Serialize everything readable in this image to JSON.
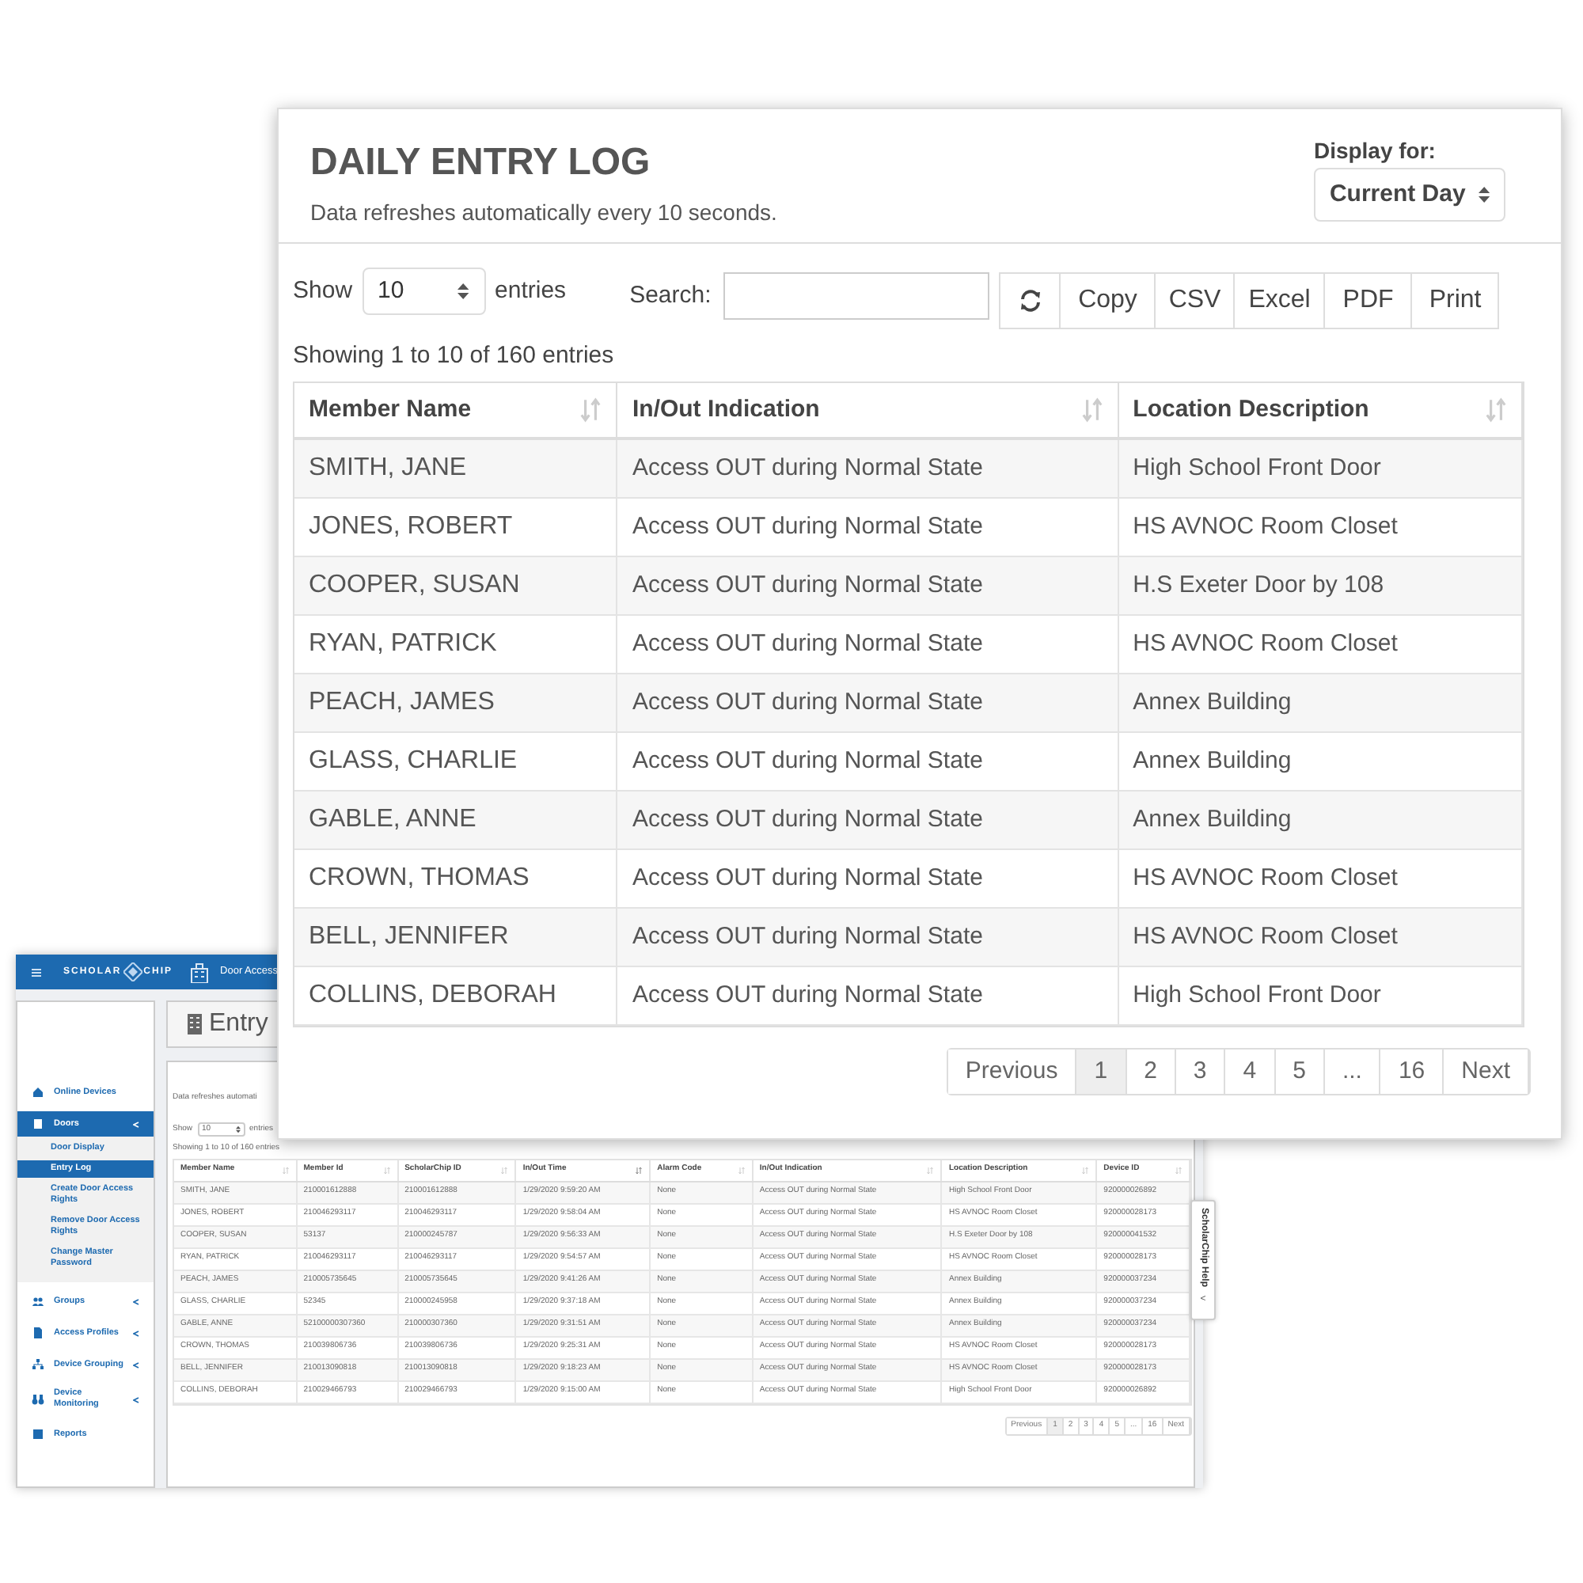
{
  "back_window": {
    "header": {
      "logo_left": "SCHOLAR",
      "logo_right": "CHIP",
      "app_title": "Door Access"
    },
    "sidebar": {
      "items": [
        {
          "label": "Online Devices",
          "selected": false,
          "expandable": false
        },
        {
          "label": "Doors",
          "selected": true,
          "expandable": true,
          "children": [
            {
              "label": "Door Display",
              "selected": false
            },
            {
              "label": "Entry Log",
              "selected": true
            },
            {
              "label": "Create Door Access Rights",
              "selected": false
            },
            {
              "label": "Remove Door Access Rights",
              "selected": false
            },
            {
              "label": "Change Master Password",
              "selected": false
            }
          ]
        },
        {
          "label": "Groups",
          "selected": false,
          "expandable": true
        },
        {
          "label": "Access Profiles",
          "selected": false,
          "expandable": true
        },
        {
          "label": "Device Grouping",
          "selected": false,
          "expandable": true
        },
        {
          "label": "Device Monitoring",
          "selected": false,
          "expandable": true
        },
        {
          "label": "Reports",
          "selected": false,
          "expandable": false
        }
      ]
    },
    "page_title": "Entry",
    "subtitle": "Data refreshes automati",
    "show_label": "Show",
    "page_size": "10",
    "entries_label": "entries",
    "info": "Showing 1 to 10 of 160 entries",
    "table": {
      "columns": [
        "Member Name",
        "Member Id",
        "ScholarChip ID",
        "In/Out Time",
        "Alarm Code",
        "In/Out Indication",
        "Location Description",
        "Device ID"
      ],
      "rows": [
        [
          "SMITH, JANE",
          "210001612888",
          "210001612888",
          "1/29/2020 9:59:20 AM",
          "None",
          "Access OUT during Normal State",
          "High School Front Door",
          "920000026892"
        ],
        [
          "JONES, ROBERT",
          "210046293117",
          "210046293117",
          "1/29/2020 9:58:04 AM",
          "None",
          "Access OUT during Normal State",
          "HS AVNOC Room Closet",
          "920000028173"
        ],
        [
          "COOPER, SUSAN",
          "53137",
          "210000245787",
          "1/29/2020 9:56:33 AM",
          "None",
          "Access OUT during Normal State",
          "H.S Exeter Door by 108",
          "920000041532"
        ],
        [
          "RYAN, PATRICK",
          "210046293117",
          "210046293117",
          "1/29/2020 9:54:57 AM",
          "None",
          "Access OUT during Normal State",
          "HS AVNOC Room Closet",
          "920000028173"
        ],
        [
          "PEACH, JAMES",
          "210005735645",
          "210005735645",
          "1/29/2020 9:41:26 AM",
          "None",
          "Access OUT during Normal State",
          "Annex Building",
          "920000037234"
        ],
        [
          "GLASS, CHARLIE",
          "52345",
          "210000245958",
          "1/29/2020 9:37:18 AM",
          "None",
          "Access OUT during Normal State",
          "Annex Building",
          "920000037234"
        ],
        [
          "GABLE, ANNE",
          "52100000307360",
          "210000307360",
          "1/29/2020 9:31:51 AM",
          "None",
          "Access OUT during Normal State",
          "Annex Building",
          "920000037234"
        ],
        [
          "CROWN, THOMAS",
          "210039806736",
          "210039806736",
          "1/29/2020 9:25:31 AM",
          "None",
          "Access OUT during Normal State",
          "HS AVNOC Room Closet",
          "920000028173"
        ],
        [
          "BELL, JENNIFER",
          "210013090818",
          "210013090818",
          "1/29/2020 9:18:23 AM",
          "None",
          "Access OUT during Normal State",
          "HS AVNOC Room Closet",
          "920000028173"
        ],
        [
          "COLLINS, DEBORAH",
          "210029466793",
          "210029466793",
          "1/29/2020 9:15:00 AM",
          "None",
          "Access OUT during Normal State",
          "High School Front Door",
          "920000026892"
        ]
      ]
    },
    "pagination": [
      {
        "label": "Previous",
        "selected": false
      },
      {
        "label": "1",
        "selected": true
      },
      {
        "label": "2",
        "selected": false
      },
      {
        "label": "3",
        "selected": false
      },
      {
        "label": "4",
        "selected": false
      },
      {
        "label": "5",
        "selected": false
      },
      {
        "label": "...",
        "selected": false
      },
      {
        "label": "16",
        "selected": false
      },
      {
        "label": "Next",
        "selected": false
      }
    ],
    "help_tab": {
      "label": "ScholarChip Help",
      "toggle": "<"
    }
  },
  "front_card": {
    "title": "DAILY ENTRY LOG",
    "subtitle": "Data refreshes automatically every 10 seconds.",
    "display_for": {
      "label": "Display for:",
      "value": "Current Day"
    },
    "show_label": "Show",
    "page_size": "10",
    "entries_label": "entries",
    "search_label": "Search:",
    "buttons": [
      "Copy",
      "CSV",
      "Excel",
      "PDF",
      "Print"
    ],
    "info": "Showing 1 to 10 of 160 entries",
    "table": {
      "columns": [
        "Member Name",
        "In/Out Indication",
        "Location Description"
      ],
      "rows": [
        [
          "SMITH, JANE",
          "Access OUT during Normal State",
          "High School Front Door"
        ],
        [
          "JONES, ROBERT",
          "Access OUT during Normal State",
          "HS AVNOC Room Closet"
        ],
        [
          "COOPER, SUSAN",
          "Access OUT during Normal State",
          "H.S Exeter Door by 108"
        ],
        [
          "RYAN, PATRICK",
          "Access OUT during Normal State",
          "HS AVNOC Room Closet"
        ],
        [
          "PEACH, JAMES",
          "Access OUT during Normal State",
          "Annex Building"
        ],
        [
          "GLASS, CHARLIE",
          "Access OUT during Normal State",
          "Annex Building"
        ],
        [
          "GABLE, ANNE",
          "Access OUT during Normal State",
          "Annex Building"
        ],
        [
          "CROWN, THOMAS",
          "Access OUT during Normal State",
          "HS AVNOC Room Closet"
        ],
        [
          "BELL, JENNIFER",
          "Access OUT during Normal State",
          "HS AVNOC Room Closet"
        ],
        [
          "COLLINS, DEBORAH",
          "Access OUT during Normal State",
          "High School Front Door"
        ]
      ]
    },
    "pagination": [
      {
        "label": "Previous",
        "selected": false
      },
      {
        "label": "1",
        "selected": true
      },
      {
        "label": "2",
        "selected": false
      },
      {
        "label": "3",
        "selected": false
      },
      {
        "label": "4",
        "selected": false
      },
      {
        "label": "5",
        "selected": false
      },
      {
        "label": "...",
        "selected": false
      },
      {
        "label": "16",
        "selected": false
      },
      {
        "label": "Next",
        "selected": false
      }
    ]
  }
}
